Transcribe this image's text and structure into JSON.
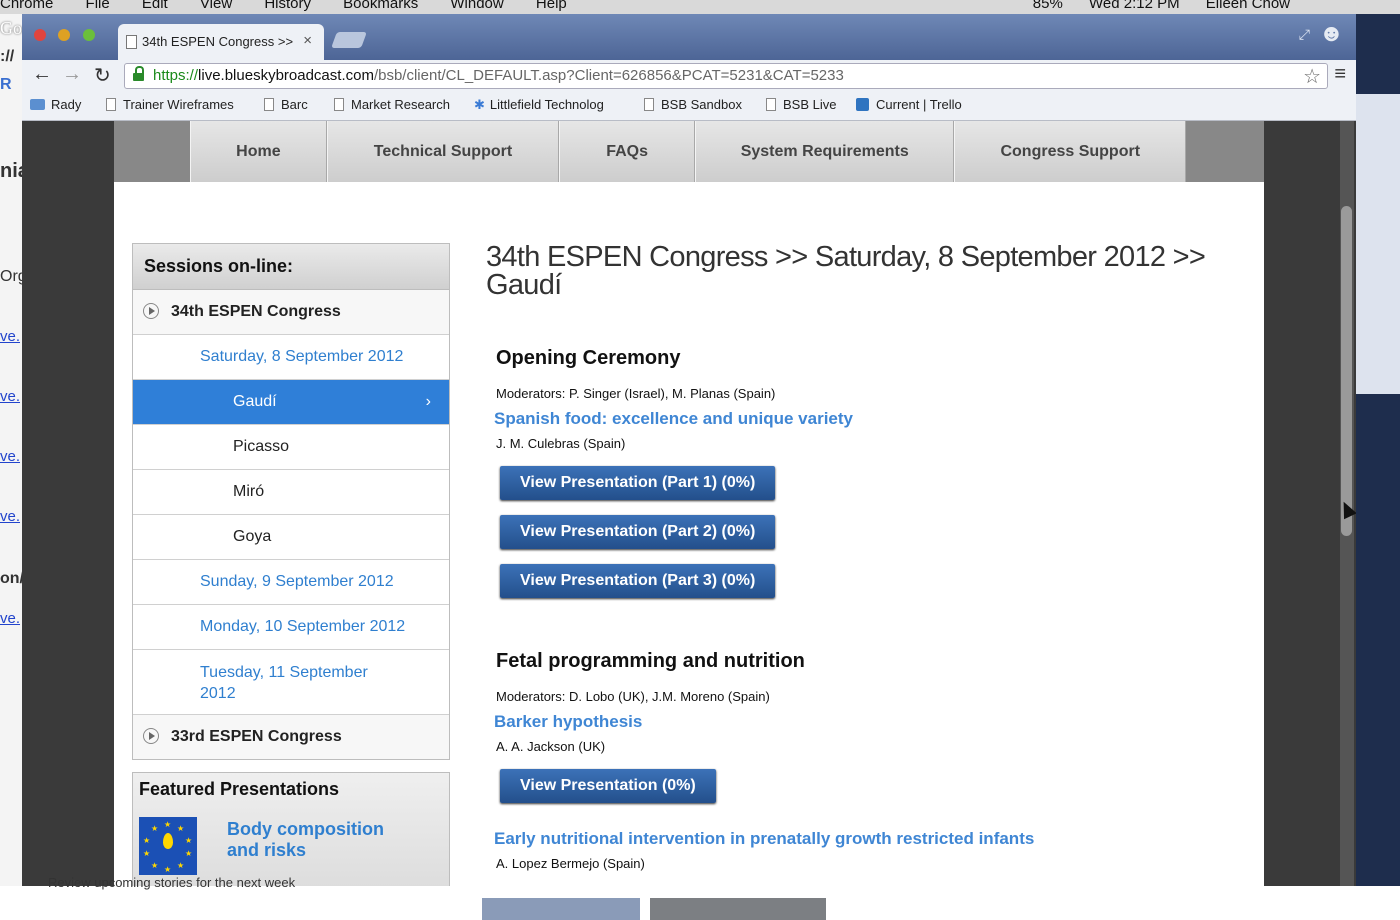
{
  "os_menubar": {
    "items": [
      "Chrome",
      "File",
      "Edit",
      "View",
      "History",
      "Bookmarks",
      "Window",
      "Help"
    ],
    "status": [
      "85%",
      "Wed 2:12 PM",
      "Eileen Chow"
    ]
  },
  "left_window": {
    "logo_text": "Google+",
    "links": [
      "ve.",
      "ve.",
      "ve.",
      "ve.",
      "ve."
    ],
    "fragments": [
      "://",
      "R",
      "nia",
      "Org",
      "on/"
    ]
  },
  "browser": {
    "tab_title": "34th ESPEN Congress >> ",
    "tab_close": "×",
    "back": "←",
    "forward": "→",
    "reload": "↻",
    "url_scheme": "https://",
    "url_host": "live.blueskybroadcast.com",
    "url_path": "/bsb/client/CL_DEFAULT.asp?Client=626856&PCAT=5231&CAT=5233",
    "star": "☆",
    "menu": "≡",
    "bookmarks": [
      "Rady",
      "Trainer Wireframes",
      "Barc",
      "Market Research",
      "Littlefield Technolog",
      "BSB Sandbox",
      "BSB Live",
      "Current | Trello"
    ]
  },
  "site_nav": {
    "items": [
      "Home",
      "Technical Support",
      "FAQs",
      "System Requirements",
      "Congress Support"
    ]
  },
  "sidebar": {
    "heading": "Sessions on-line:",
    "congress_1": "34th ESPEN Congress",
    "day_1": "Saturday, 8 September 2012",
    "rooms": [
      "Gaudí",
      "Picasso",
      "Miró",
      "Goya"
    ],
    "active_chevron": "›",
    "day_2": "Sunday, 9 September 2012",
    "day_3": "Monday, 10 September 2012",
    "day_4": "Tuesday, 11 September 2012",
    "congress_2": "33rd ESPEN Congress"
  },
  "featured": {
    "heading": "Featured Presentations",
    "title": "Body composition and risks"
  },
  "main": {
    "breadcrumb": "34th ESPEN Congress >> Saturday, 8 September 2012 >> Gaudí",
    "sessions": [
      {
        "title": "Opening Ceremony",
        "moderators": "Moderators: P. Singer (Israel), M. Planas (Spain)",
        "talk_title": "Spanish food: excellence and unique variety",
        "author": "J. M. Culebras (Spain)",
        "buttons": [
          "View Presentation (Part 1)  (0%)",
          "View Presentation (Part 2)  (0%)",
          "View Presentation (Part 3)  (0%)"
        ]
      },
      {
        "title": "Fetal programming and nutrition",
        "moderators": "Moderators: D. Lobo (UK), J.M. Moreno (Spain)",
        "talk_title": "Barker hypothesis",
        "author": "A. A. Jackson (UK)",
        "button": "View Presentation  (0%)",
        "talk2_title": "Early nutritional intervention in prenatally growth restricted infants",
        "talk2_author": "A. Lopez Bermejo (Spain)"
      }
    ]
  },
  "bottom_bar": {
    "text": "Review upcoming stories for the next week"
  },
  "colors": {
    "accent_blue": "#2f7fd8",
    "link_blue": "#3f86d4",
    "button_blue": "#2f5f9f"
  }
}
